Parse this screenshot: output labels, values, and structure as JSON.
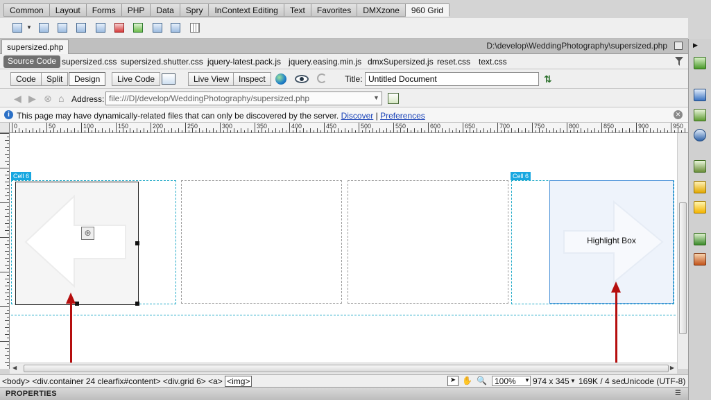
{
  "insert_bar": {
    "tabs": [
      "Common",
      "Layout",
      "Forms",
      "PHP",
      "Data",
      "Spry",
      "InContext Editing",
      "Text",
      "Favorites",
      "DMXzone",
      "960 Grid"
    ],
    "active_tab": "960 Grid"
  },
  "document": {
    "tab_name": "supersized.php",
    "path": "D:\\develop\\WeddingPhotography\\supersized.php"
  },
  "related_files": [
    "Source Code",
    "supersized.css",
    "supersized.shutter.css",
    "jquery-latest.pack.js",
    "jquery.easing.min.js",
    "dmxSupersized.js",
    "reset.css",
    "text.css"
  ],
  "doc_toolbar": {
    "code": "Code",
    "split": "Split",
    "design": "Design",
    "live_code": "Live Code",
    "live_view": "Live View",
    "inspect": "Inspect",
    "title_label": "Title:",
    "title_value": "Untitled Document"
  },
  "nav": {
    "address_label": "Address:",
    "address_value": "file:///D|/develop/WeddingPhotography/supersized.php"
  },
  "info_bar": {
    "message": "This page may have dynamically-related files that can only be discovered by the server.",
    "discover": "Discover",
    "separator": "|",
    "preferences": "Preferences"
  },
  "ruler": {
    "h_labels": [
      "0",
      "50",
      "100",
      "150",
      "200",
      "250",
      "300",
      "350",
      "400",
      "450",
      "500",
      "550",
      "600",
      "650",
      "700",
      "750",
      "800",
      "850",
      "900",
      "950"
    ]
  },
  "canvas": {
    "left_cell_label": "Cell 6",
    "right_cell_label": "Cell 6",
    "highlight_text": "Highlight Box"
  },
  "status_bar": {
    "tag_path": "<body> <div.container 24 clearfix#content> <div.grid 6> <a>",
    "selected_tag": "<img>",
    "zoom": "100%",
    "dimensions": "974 x 345",
    "filesize": "169K / 4 sec",
    "encoding": "Unicode (UTF-8)"
  },
  "properties_label": "PROPERTIES",
  "colors": {
    "accent": "#18a7e0",
    "arrow": "#b50e0e",
    "highlight_bg": "#eef3fb"
  }
}
